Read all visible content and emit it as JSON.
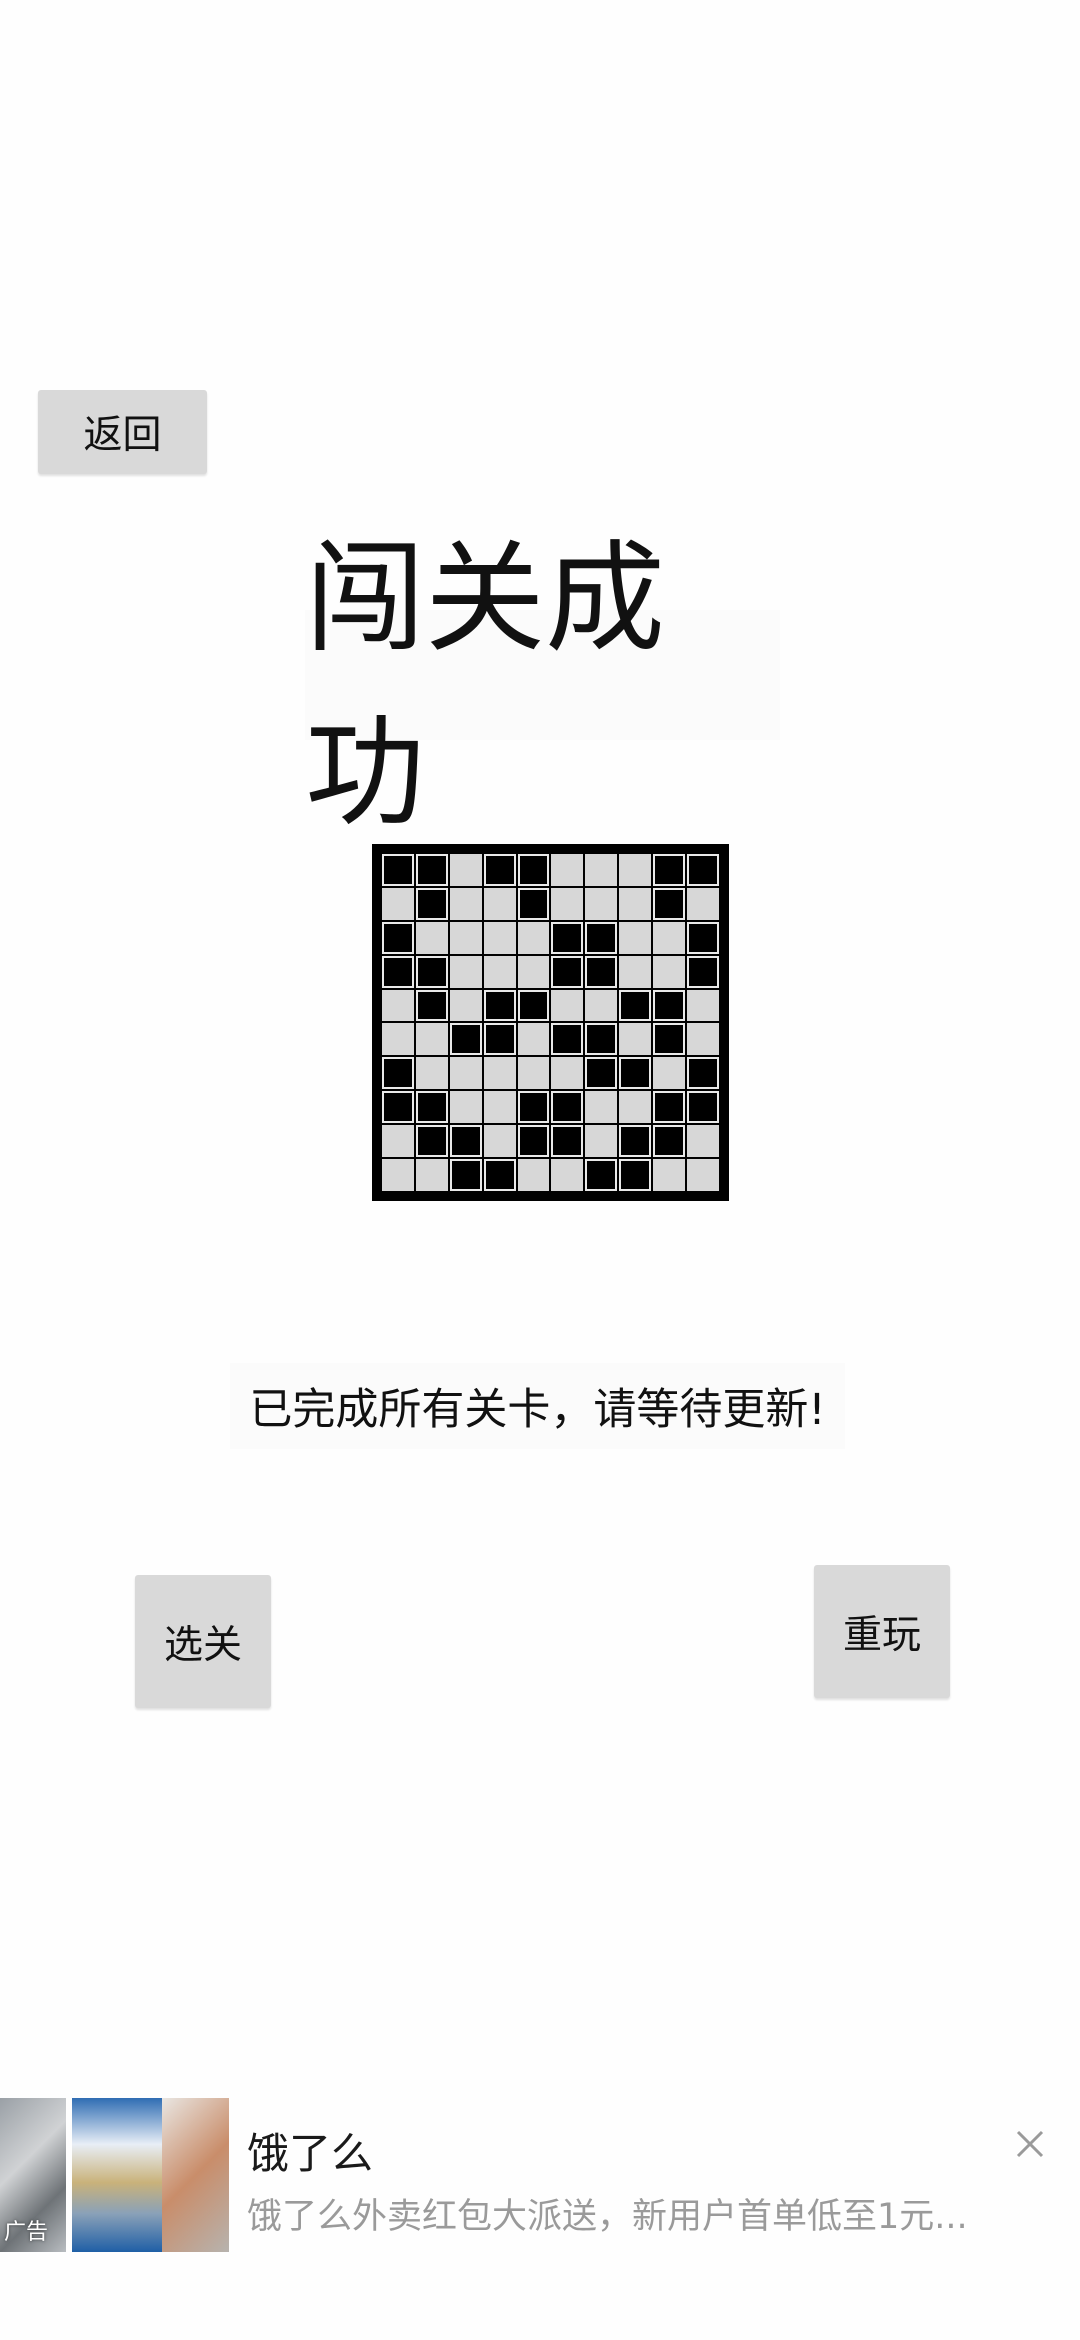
{
  "back_button": "返回",
  "title": "闯关成功",
  "message": "已完成所有关卡，请等待更新!",
  "select_level_button": "选关",
  "replay_button": "重玩",
  "board": {
    "rows": 10,
    "cols": 10,
    "cells": [
      [
        1,
        1,
        0,
        1,
        1,
        0,
        0,
        0,
        1,
        1
      ],
      [
        0,
        1,
        0,
        0,
        1,
        0,
        0,
        0,
        1,
        0
      ],
      [
        1,
        0,
        0,
        0,
        0,
        1,
        1,
        0,
        0,
        1
      ],
      [
        1,
        1,
        0,
        0,
        0,
        1,
        1,
        0,
        0,
        1
      ],
      [
        0,
        1,
        0,
        1,
        1,
        0,
        0,
        1,
        1,
        0
      ],
      [
        0,
        0,
        1,
        1,
        0,
        1,
        1,
        0,
        1,
        0
      ],
      [
        1,
        0,
        0,
        0,
        0,
        0,
        1,
        1,
        0,
        1
      ],
      [
        1,
        1,
        0,
        0,
        1,
        1,
        0,
        0,
        1,
        1
      ],
      [
        0,
        1,
        1,
        0,
        1,
        1,
        0,
        1,
        1,
        0
      ],
      [
        0,
        0,
        1,
        1,
        0,
        0,
        1,
        1,
        0,
        0
      ]
    ]
  },
  "ad": {
    "label": "广告",
    "title": "饿了么",
    "description": "饿了么外卖红包大派送，新用户首单低至1元..."
  }
}
